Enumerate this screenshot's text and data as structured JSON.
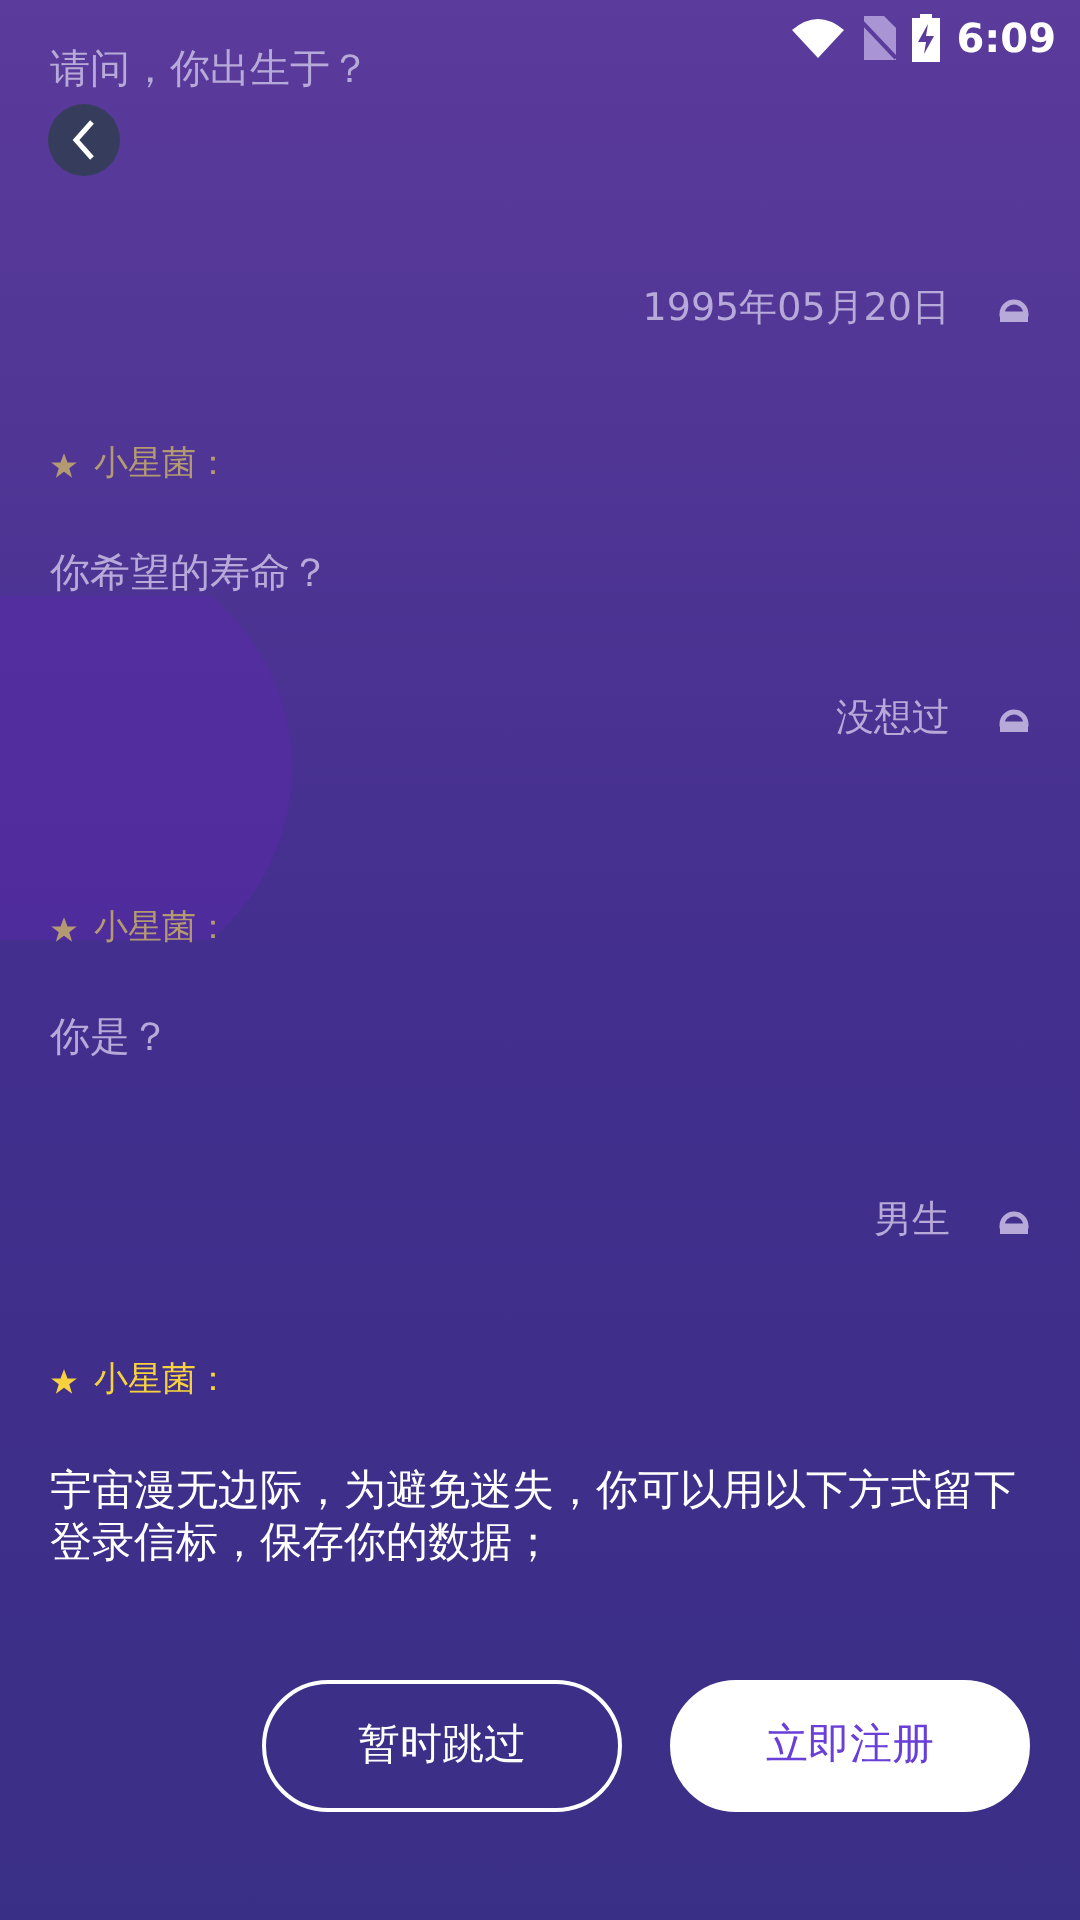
{
  "status_bar": {
    "time": "6:09"
  },
  "messages": [
    {
      "kind": "question",
      "text": "请问，你出生于？",
      "dimmed": true
    },
    {
      "kind": "answer",
      "text": "1995年05月20日",
      "dimmed": true
    },
    {
      "kind": "question",
      "speaker": "小星菌：",
      "text": "你希望的寿命？",
      "dimmed": true
    },
    {
      "kind": "answer",
      "text": "没想过",
      "dimmed": true
    },
    {
      "kind": "question",
      "speaker": "小星菌：",
      "text": "你是？",
      "dimmed": true
    },
    {
      "kind": "answer",
      "text": "男生",
      "dimmed": true
    },
    {
      "kind": "question",
      "speaker": "小星菌：",
      "text": "宇宙漫无边际，为避免迷失，你可以用以下方式留下登录信标，保存你的数据；",
      "dimmed": false
    }
  ],
  "buttons": [
    {
      "label": "暂时跳过",
      "kind": "outline"
    },
    {
      "label": "立即注册",
      "kind": "solid"
    }
  ]
}
